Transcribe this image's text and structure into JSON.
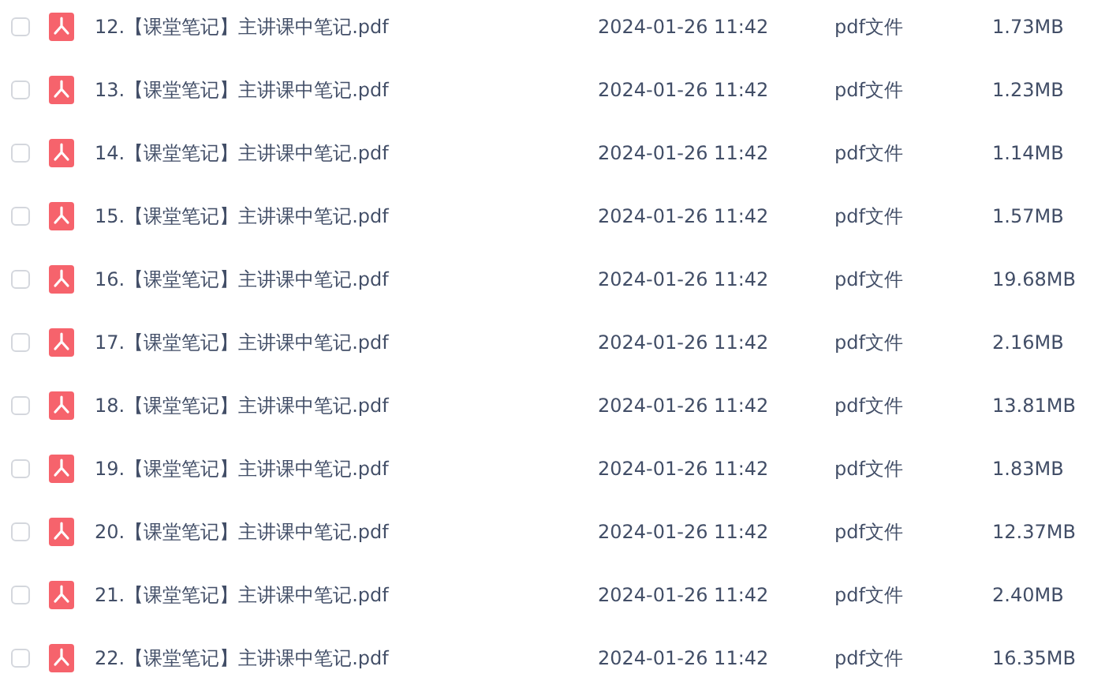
{
  "files": [
    {
      "name": "12.【课堂笔记】主讲课中笔记.pdf",
      "date": "2024-01-26 11:42",
      "type": "pdf文件",
      "size": "1.73MB",
      "selected": false
    },
    {
      "name": "13.【课堂笔记】主讲课中笔记.pdf",
      "date": "2024-01-26 11:42",
      "type": "pdf文件",
      "size": "1.23MB",
      "selected": false
    },
    {
      "name": "14.【课堂笔记】主讲课中笔记.pdf",
      "date": "2024-01-26 11:42",
      "type": "pdf文件",
      "size": "1.14MB",
      "selected": false
    },
    {
      "name": "15.【课堂笔记】主讲课中笔记.pdf",
      "date": "2024-01-26 11:42",
      "type": "pdf文件",
      "size": "1.57MB",
      "selected": false
    },
    {
      "name": "16.【课堂笔记】主讲课中笔记.pdf",
      "date": "2024-01-26 11:42",
      "type": "pdf文件",
      "size": "19.68MB",
      "selected": false
    },
    {
      "name": "17.【课堂笔记】主讲课中笔记.pdf",
      "date": "2024-01-26 11:42",
      "type": "pdf文件",
      "size": "2.16MB",
      "selected": false
    },
    {
      "name": "18.【课堂笔记】主讲课中笔记.pdf",
      "date": "2024-01-26 11:42",
      "type": "pdf文件",
      "size": "13.81MB",
      "selected": false
    },
    {
      "name": "19.【课堂笔记】主讲课中笔记.pdf",
      "date": "2024-01-26 11:42",
      "type": "pdf文件",
      "size": "1.83MB",
      "selected": false
    },
    {
      "name": "20.【课堂笔记】主讲课中笔记.pdf",
      "date": "2024-01-26 11:42",
      "type": "pdf文件",
      "size": "12.37MB",
      "selected": false
    },
    {
      "name": "21.【课堂笔记】主讲课中笔记.pdf",
      "date": "2024-01-26 11:42",
      "type": "pdf文件",
      "size": "2.40MB",
      "selected": false
    },
    {
      "name": "22.【课堂笔记】主讲课中笔记.pdf",
      "date": "2024-01-26 11:42",
      "type": "pdf文件",
      "size": "16.35MB",
      "selected": false
    }
  ]
}
